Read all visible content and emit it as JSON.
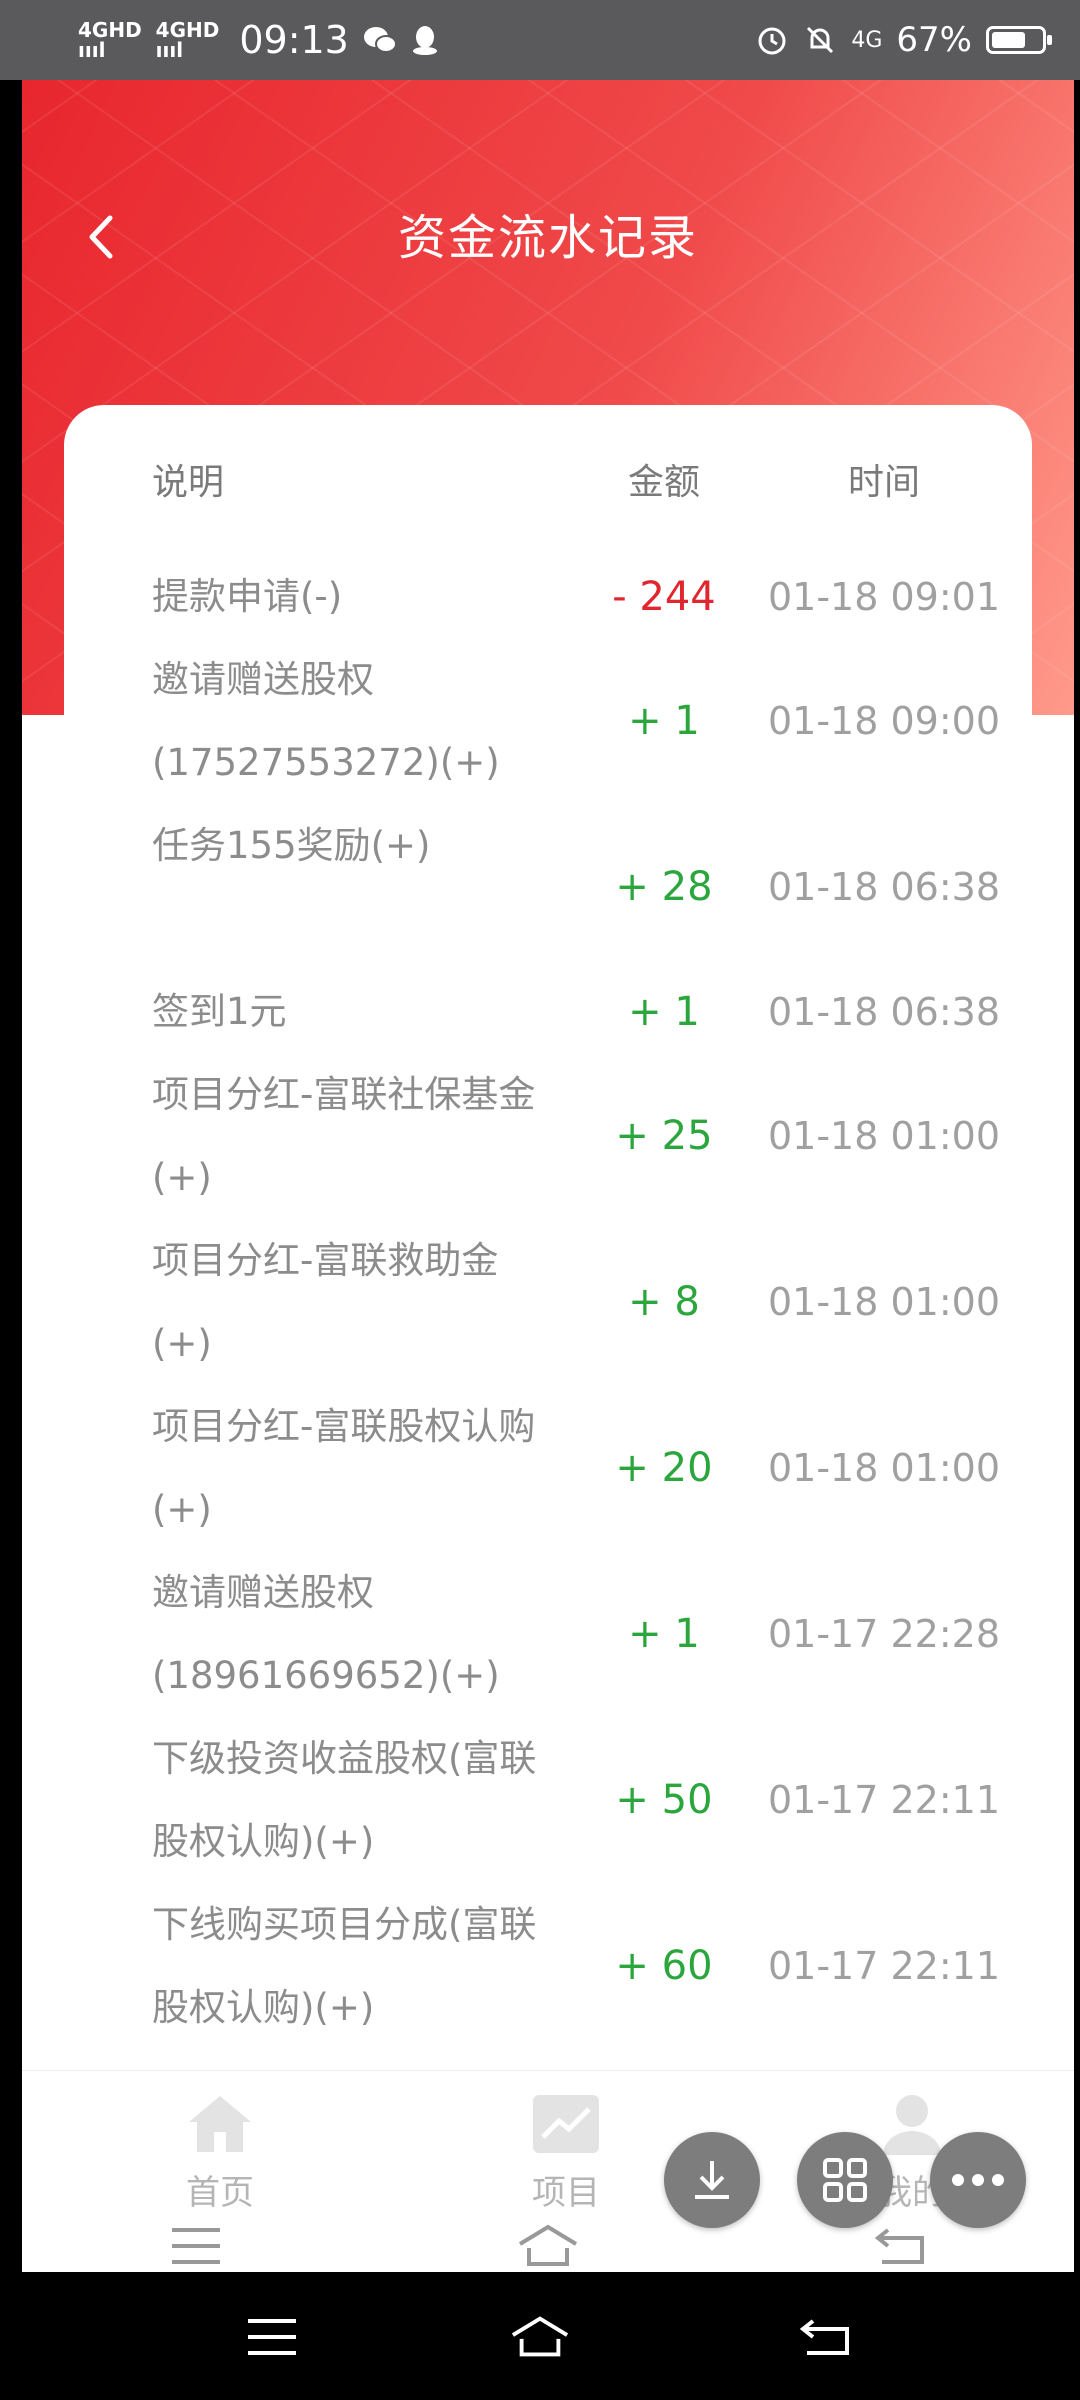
{
  "status_bar": {
    "signal_1": "4GHD",
    "signal_2": "4GHD",
    "time": "09:13",
    "network": "4G",
    "battery": "67%",
    "battery_level": 0.67
  },
  "header": {
    "title": "资金流水记录"
  },
  "table": {
    "columns": [
      "说明",
      "金额",
      "时间"
    ],
    "rows": [
      {
        "desc": "提款申请(-)",
        "amount": "- 244",
        "time": "01-18 09:01",
        "type": "neg"
      },
      {
        "desc": "邀请赠送股权(17527553272)(+)",
        "amount": "+ 1",
        "time": "01-18 09:00",
        "type": "pos"
      },
      {
        "desc": "任务155奖励(+)",
        "amount": "+ 28",
        "time": "01-18 06:38",
        "type": "pos"
      },
      {
        "desc": "签到1元",
        "amount": "+ 1",
        "time": "01-18 06:38",
        "type": "pos"
      },
      {
        "desc": "项目分红-富联社保基金(+)",
        "amount": "+ 25",
        "time": "01-18 01:00",
        "type": "pos"
      },
      {
        "desc": "项目分红-富联救助金(+)",
        "amount": "+ 8",
        "time": "01-18 01:00",
        "type": "pos"
      },
      {
        "desc": "项目分红-富联股权认购(+)",
        "amount": "+ 20",
        "time": "01-18 01:00",
        "type": "pos"
      },
      {
        "desc": "邀请赠送股权(18961669652)(+)",
        "amount": "+ 1",
        "time": "01-17 22:28",
        "type": "pos"
      },
      {
        "desc": "下级投资收益股权(富联股权认购)(+)",
        "amount": "+ 50",
        "time": "01-17 22:11",
        "type": "pos"
      },
      {
        "desc": "下线购买项目分成(富联股权认购)(+)",
        "amount": "+ 60",
        "time": "01-17 22:11",
        "type": "pos"
      }
    ]
  },
  "tabbar": {
    "home": "首页",
    "project": "项目",
    "mine": "我的"
  },
  "colors": {
    "header_red": "#e8262e",
    "positive": "#2aa63c",
    "negative": "#e0262e"
  }
}
